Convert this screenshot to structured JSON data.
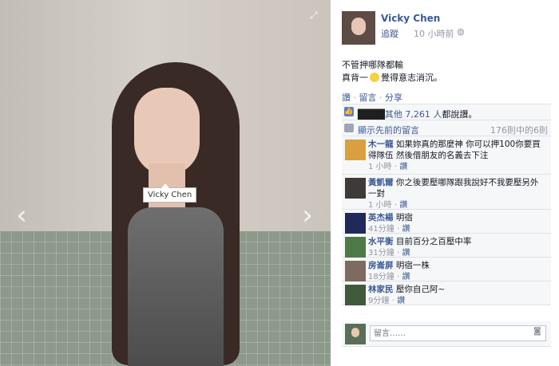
{
  "photo": {
    "tag_label": "Vicky Chen",
    "prev_arrow": "‹",
    "next_arrow": "›",
    "expand_icon": "⤢"
  },
  "post": {
    "author": "Vicky Chen",
    "follow": "追蹤",
    "time": "10 小時前",
    "globe": "◍",
    "caption_line1": "不管押哪隊都輸",
    "caption_line2_a": "真背一",
    "caption_line2_b": "覺得意志消沉。"
  },
  "actions": {
    "like": "讚",
    "comment": "留言",
    "share": "分享",
    "sep": "·"
  },
  "likes": {
    "others": "其他 7,261 人",
    "suffix": "都說讚。",
    "icon": "👍"
  },
  "previous": {
    "label": "顯示先前的留言",
    "count": "176則中的6則"
  },
  "comments": [
    {
      "name": "木一龍",
      "text": "如果妳真的那麼神 你可以押100你要買得隊伍 然後借朋友的名義去下注",
      "time": "1 小時",
      "like": "讚",
      "avatar_color": "#d8a040"
    },
    {
      "name": "黃凱爾",
      "text": "你之後要壓哪隊跟我說好不我要壓另外一對",
      "time": "1 小時",
      "like": "讚",
      "avatar_color": "#3e3a38"
    },
    {
      "name": "英杰楊",
      "text": "明宿",
      "time": "41分鐘",
      "like": "讚",
      "avatar_color": "#1f2a5a"
    },
    {
      "name": "水平衡",
      "text": "目前百分之百壓中率",
      "time": "31分鐘",
      "like": "讚",
      "avatar_color": "#4d7a46"
    },
    {
      "name": "房崙屏",
      "text": "明宿一株",
      "time": "18分鐘",
      "like": "讚",
      "avatar_color": "#7d6b60"
    },
    {
      "name": "林家民",
      "text": "壓你自己阿~",
      "time": "9分鐘",
      "like": "讚",
      "avatar_color": "#3f5a3a"
    }
  ],
  "composer": {
    "placeholder": "留言……",
    "camera": "◙"
  }
}
